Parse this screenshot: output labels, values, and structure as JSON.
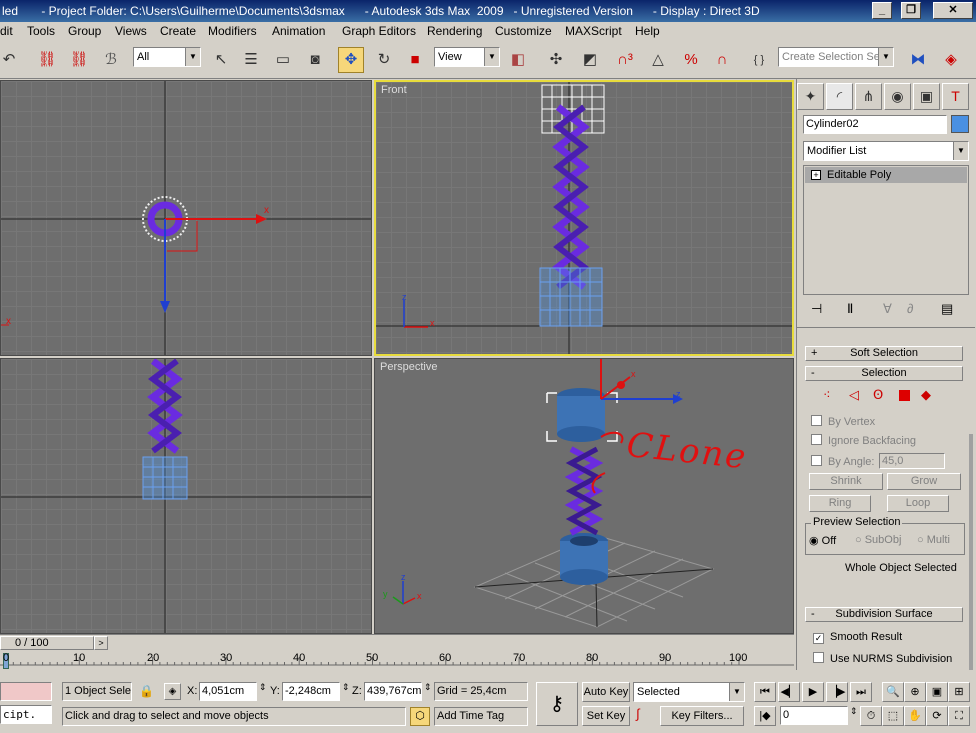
{
  "titlebar": {
    "text": "led       - Project Folder: C:\\Users\\Guilherme\\Documents\\3dsmax      - Autodesk 3ds Max  2009   - Unregistered Version      - Display : Direct 3D",
    "minimize": "_",
    "restore": "❐",
    "close": "✕"
  },
  "menu": [
    "dit",
    "Tools",
    "Group",
    "Views",
    "Create",
    "Modifiers",
    "Animation",
    "Graph Editors",
    "Rendering",
    "Customize",
    "MAXScript",
    "Help"
  ],
  "toolbar": {
    "filter_value": "All",
    "refcoord_value": "View",
    "selection_set_placeholder": "Create Selection Set"
  },
  "viewports": {
    "top_left_label": "",
    "front_label": "Front",
    "bottom_left_label": "",
    "perspective_label": "Perspective",
    "axis_x": "x",
    "axis_z": "z",
    "axis_y": "y",
    "annotation": "CLone"
  },
  "command_panel": {
    "object_name": "Cylinder02",
    "object_color": "#4a90e2",
    "modifier_list": "Modifier List",
    "stack_item": "Editable Poly",
    "soft_selection": "Soft Selection",
    "selection": "Selection",
    "by_vertex": "By Vertex",
    "ignore_backfacing": "Ignore Backfacing",
    "by_angle": "By Angle:",
    "angle_value": "45,0",
    "shrink": "Shrink",
    "grow": "Grow",
    "ring": "Ring",
    "loop": "Loop",
    "preview_selection": "Preview Selection",
    "off": "Off",
    "subobj": "SubObj",
    "multi": "Multi",
    "whole_object": "Whole Object Selected",
    "subdivision_surface": "Subdivision Surface",
    "smooth_result": "Smooth Result",
    "use_nurms": "Use NURMS Subdivision"
  },
  "timeline": {
    "frame_counter": "0 / 100",
    "ticks": [
      "0",
      "10",
      "20",
      "30",
      "40",
      "50",
      "60",
      "70",
      "80",
      "90",
      "100"
    ]
  },
  "status": {
    "script_listener": "cipt.",
    "selection_count": "1 Object Sele",
    "x_label": "X:",
    "x_value": "4,051cm",
    "y_label": "Y:",
    "y_value": "-2,248cm",
    "z_label": "Z:",
    "z_value": "439,767cm",
    "grid": "Grid = 25,4cm",
    "prompt": "Click and drag to select and move objects",
    "add_time_tag": "Add Time Tag",
    "auto_key": "Auto Key",
    "set_key": "Set Key",
    "selected_value": "Selected",
    "key_filters": "Key Filters...",
    "current_frame": "0"
  }
}
